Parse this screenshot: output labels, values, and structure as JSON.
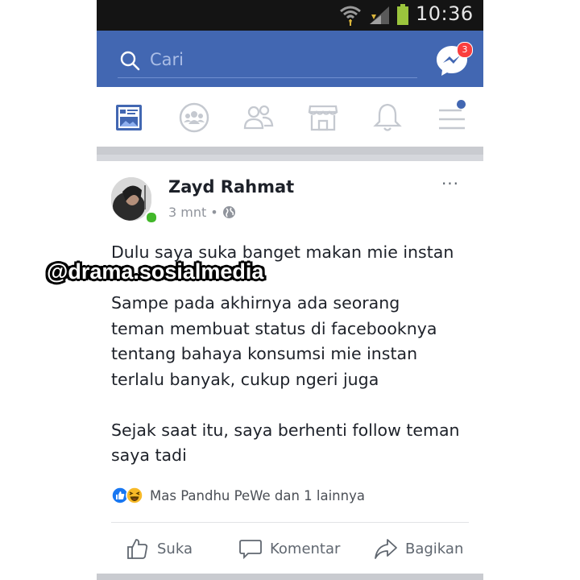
{
  "status_bar": {
    "time": "10:36"
  },
  "header": {
    "search_placeholder": "Cari",
    "messenger_badge": "3"
  },
  "tabs": [
    {
      "name": "news-feed",
      "icon": "news-feed-icon",
      "active": true
    },
    {
      "name": "groups",
      "icon": "groups-icon"
    },
    {
      "name": "friends",
      "icon": "friends-icon"
    },
    {
      "name": "marketplace",
      "icon": "marketplace-icon"
    },
    {
      "name": "notifications",
      "icon": "bell-icon"
    },
    {
      "name": "menu",
      "icon": "hamburger-icon",
      "has_dot": true
    }
  ],
  "post": {
    "author": "Zayd Rahmat",
    "time": "3 mnt",
    "dot": "•",
    "more": "···",
    "paragraphs": [
      [
        "Dulu saya suka banget makan mie instan"
      ],
      [
        "Sampe pada akhirnya ada seorang",
        "teman membuat status di facebooknya",
        "tentang bahaya konsumsi mie instan",
        "terlalu banyak, cukup ngeri juga"
      ],
      [
        "Sejak saat itu, saya berhenti follow teman",
        "saya tadi"
      ]
    ],
    "reactions_text": "Mas Pandhu PeWe dan 1 lainnya",
    "actions": {
      "like": "Suka",
      "comment": "Komentar",
      "share": "Bagikan"
    }
  },
  "watermark": "@drama.sosialmedia",
  "colors": {
    "brand_blue": "#4267b2",
    "status_bar": "#141414",
    "badge_red": "#fa3e3e",
    "online_green": "#42b72a",
    "like_blue": "#1877f2",
    "haha_yellow": "#f7b928"
  }
}
